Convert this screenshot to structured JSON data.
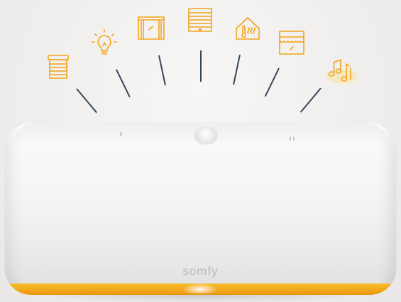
{
  "device": {
    "brand_logo": "somfy"
  },
  "accent_color": "#f3a41a",
  "rim_color": "#f3a81a",
  "ray_color": "#37465a",
  "icons": [
    {
      "name": "roller-shutter-icon"
    },
    {
      "name": "light-bulb-icon"
    },
    {
      "name": "curtains-icon"
    },
    {
      "name": "garage-door-icon"
    },
    {
      "name": "heating-icon"
    },
    {
      "name": "awning-icon"
    },
    {
      "name": "music-note-icon"
    }
  ]
}
